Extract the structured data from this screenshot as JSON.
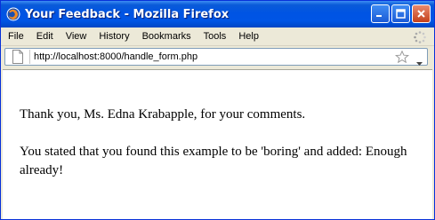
{
  "window": {
    "title": "Your Feedback - Mozilla Firefox"
  },
  "menu": [
    "File",
    "Edit",
    "View",
    "History",
    "Bookmarks",
    "Tools",
    "Help"
  ],
  "urlbar": {
    "url": "http://localhost:8000/handle_form.php"
  },
  "page": {
    "paragraph1": "Thank you, Ms. Edna Krabapple, for your comments.",
    "paragraph2": "You stated that you found this example to be 'boring' and added: Enough already!"
  },
  "icons": {
    "app": "firefox-icon",
    "page": "page-icon",
    "bookmark": "star-icon",
    "dropdown": "dropdown-arrow-icon",
    "throbber": "throbber-icon"
  }
}
